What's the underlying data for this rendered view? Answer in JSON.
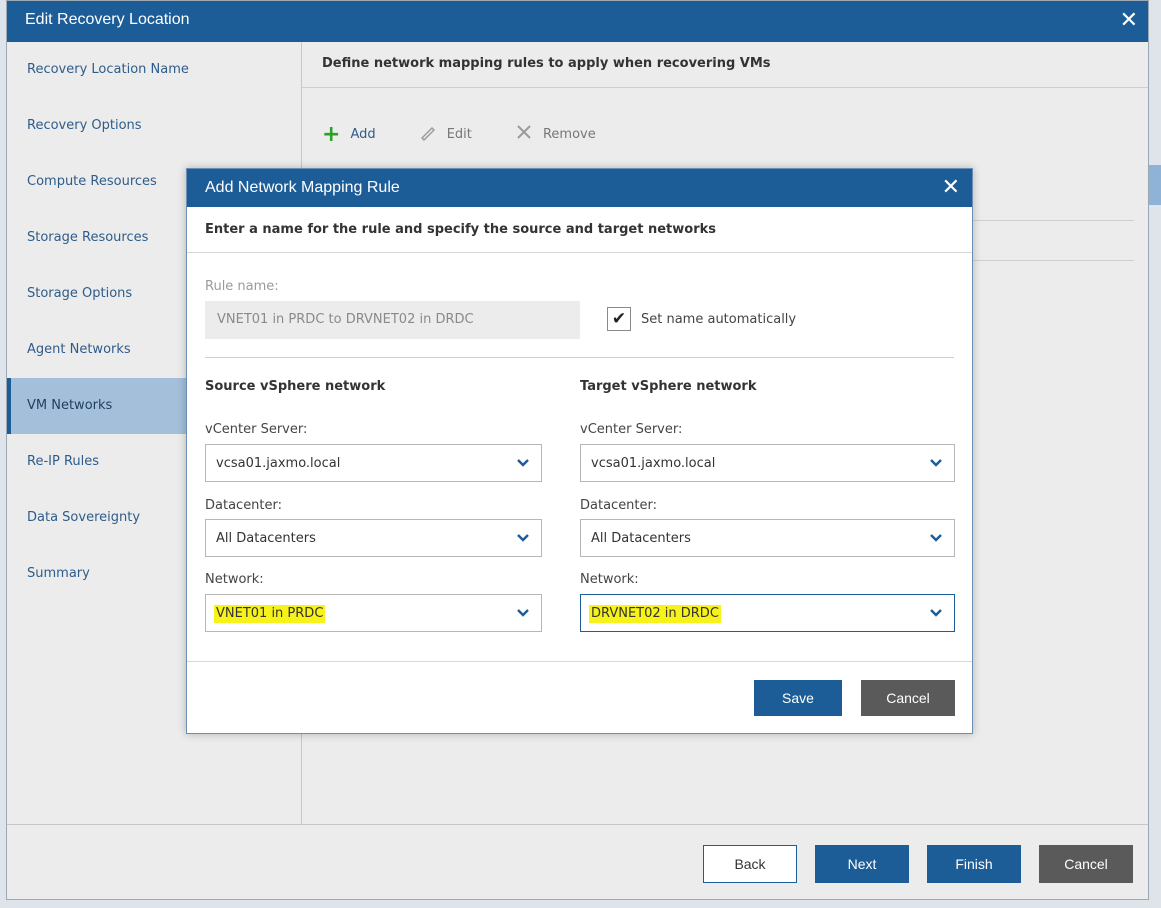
{
  "wizard": {
    "title": "Edit Recovery Location",
    "close_glyph": "✕",
    "nav": [
      {
        "label": "Recovery Location Name"
      },
      {
        "label": "Recovery Options"
      },
      {
        "label": "Compute Resources"
      },
      {
        "label": "Storage Resources"
      },
      {
        "label": "Storage Options"
      },
      {
        "label": "Agent Networks"
      },
      {
        "label": "VM Networks"
      },
      {
        "label": "Re-IP Rules"
      },
      {
        "label": "Data Sovereignty"
      },
      {
        "label": "Summary"
      }
    ],
    "active_nav": "VM Networks",
    "content_header": "Define network mapping rules to apply when recovering VMs",
    "toolbar": {
      "add": "Add",
      "edit": "Edit",
      "remove": "Remove"
    },
    "footer": {
      "back": "Back",
      "next": "Next",
      "finish": "Finish",
      "cancel": "Cancel"
    }
  },
  "modal": {
    "title": "Add Network Mapping Rule",
    "close_glyph": "✕",
    "subheader": "Enter a name for the rule and specify the source and target networks",
    "rule_name_label": "Rule name:",
    "rule_name_value": "VNET01 in PRDC to DRVNET02 in DRDC",
    "set_name_auto_label": "Set name automatically",
    "set_name_auto_checked": "✔",
    "source": {
      "heading": "Source vSphere network",
      "vcenter_label": "vCenter Server:",
      "vcenter_value": "vcsa01.jaxmo.local",
      "datacenter_label": "Datacenter:",
      "datacenter_value": "All Datacenters",
      "network_label": "Network:",
      "network_value": "VNET01 in PRDC"
    },
    "target": {
      "heading": "Target vSphere network",
      "vcenter_label": "vCenter Server:",
      "vcenter_value": "vcsa01.jaxmo.local",
      "datacenter_label": "Datacenter:",
      "datacenter_value": "All Datacenters",
      "network_label": "Network:",
      "network_value": "DRVNET02 in DRDC"
    },
    "save": "Save",
    "cancel": "Cancel"
  },
  "colors": {
    "brand_blue": "#1c5d98",
    "highlight_yellow": "#f7f21a",
    "add_green": "#2aa22a"
  }
}
